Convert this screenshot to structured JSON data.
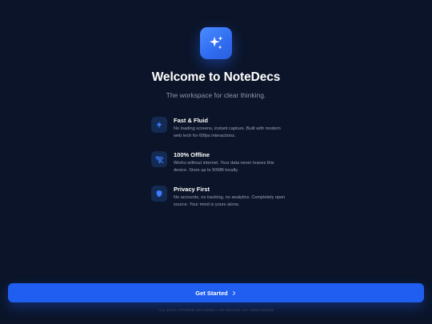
{
  "app": {
    "title": "Welcome to NoteDecs",
    "subtitle": "The workspace for clear thinking."
  },
  "features": [
    {
      "icon": "lightning-icon",
      "title": "Fast & Fluid",
      "description": "No loading screens, instant capture. Built with modern web tech for 60fps interactions."
    },
    {
      "icon": "wifi-off-icon",
      "title": "100% Offline",
      "description": "Works without internet. Your data never leaves this device. Store up to 50MB locally."
    },
    {
      "icon": "shield-icon",
      "title": "Privacy First",
      "description": "No accounts, no tracking, no analytics. Completely open source. Your mind is yours alone."
    }
  ],
  "cta": {
    "label": "Get Started"
  },
  "footer": {
    "text": "ALL DATA STORED SECURELY ON DEVICE VIA INDEXEDDB"
  },
  "colors": {
    "background": "#0b1428",
    "accent": "#1f5ef0",
    "icon_tile": "#132a52",
    "icon_fg": "#3d7bff"
  },
  "logo_icon": "sparkles-icon"
}
